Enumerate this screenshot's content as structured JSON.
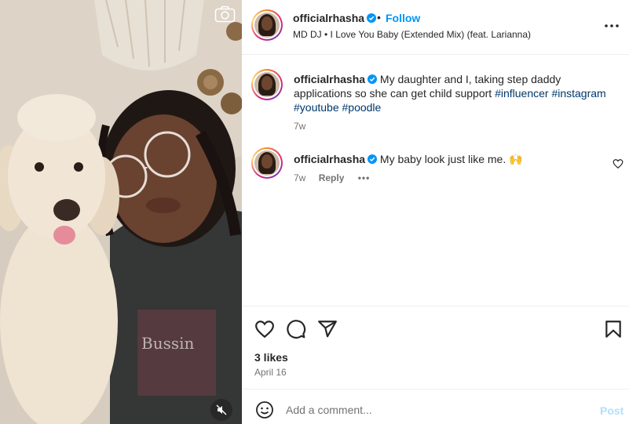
{
  "media": {
    "top_icon": "camera-icon",
    "audio_toggle_icon": "speaker-muted-icon"
  },
  "post": {
    "username": "officialrhasha",
    "separator": "•",
    "follow_label": "Follow",
    "audio_track": "MD DJ • I Love You Baby (Extended Mix) (feat. Larianna)",
    "more_icon": "more-options-icon"
  },
  "caption": {
    "username": "officialrhasha",
    "text": "My daughter and I, taking step daddy applications so she can get child support",
    "hashtags": [
      "#influencer",
      "#instagram",
      "#youtube",
      "#poodle"
    ],
    "age": "7w"
  },
  "comments": [
    {
      "username": "officialrhasha",
      "text": "My baby look just like me. 🙌",
      "age": "7w",
      "reply_label": "Reply",
      "more_label": "•••"
    }
  ],
  "actions": {
    "like_icon": "heart-icon",
    "comment_icon": "comment-icon",
    "share_icon": "share-icon",
    "save_icon": "bookmark-icon",
    "likes": "3 likes",
    "date": "April 16"
  },
  "composer": {
    "emoji_icon": "emoji-icon",
    "placeholder": "Add a comment...",
    "post_label": "Post"
  },
  "colors": {
    "accent": "#0095f6",
    "hashtag": "#00376b",
    "post_disabled": "#b2dffc",
    "muted_text": "#737373"
  }
}
